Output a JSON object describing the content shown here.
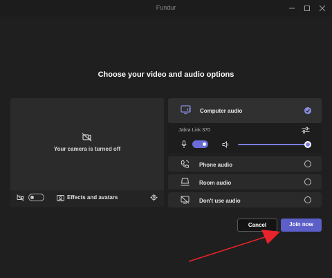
{
  "window": {
    "title": "Fundur",
    "controls": [
      "minimize-icon",
      "maximize-icon",
      "close-icon"
    ]
  },
  "heading": "Choose your video and audio options",
  "video": {
    "camera_off_text": "Your camera is turned off",
    "camera_toggle_on": false,
    "effects_label": "Effects and avatars"
  },
  "audio": {
    "options": [
      {
        "label": "Computer audio",
        "selected": true,
        "icon": "computer-audio-icon"
      },
      {
        "label": "Phone audio",
        "selected": false,
        "icon": "phone-icon"
      },
      {
        "label": "Room audio",
        "selected": false,
        "icon": "room-icon"
      },
      {
        "label": "Don't use audio",
        "selected": false,
        "icon": "no-audio-icon"
      }
    ],
    "device_name": "Jabra Link 370",
    "mic_on": true,
    "volume_level": 1.0
  },
  "buttons": {
    "cancel": "Cancel",
    "join": "Join now"
  },
  "colors": {
    "accent": "#5b5fc7",
    "annotation_arrow": "#e8232a"
  }
}
